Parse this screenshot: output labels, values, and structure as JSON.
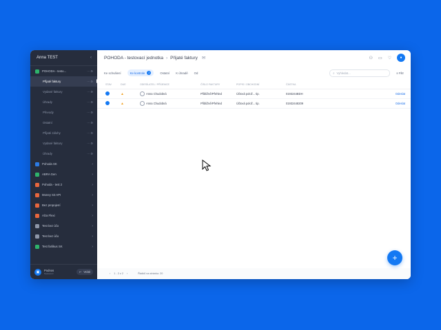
{
  "sidebar": {
    "user": "Anna TEST",
    "items": [
      {
        "label": "POHODA - testo...",
        "color": "#2eb36b",
        "tools": "⋯ ⚙",
        "sub": false,
        "active": false
      },
      {
        "label": "Přijaté faktury",
        "color": "",
        "tools": "⋯ ⚙",
        "sub": true,
        "active": true
      },
      {
        "label": "Vydané faktury",
        "color": "",
        "tools": "⋯ ⚙",
        "sub": true,
        "active": false
      },
      {
        "label": "Úhrady",
        "color": "",
        "tools": "⋯ ⚙",
        "sub": true,
        "active": false
      },
      {
        "label": "Převody",
        "color": "",
        "tools": "⋯ ⚙",
        "sub": true,
        "active": false
      },
      {
        "label": "Ostatní",
        "color": "",
        "tools": "⋯ ⚙",
        "sub": true,
        "active": false
      },
      {
        "label": "Přijaté zálohy",
        "color": "",
        "tools": "⋯ ⚙",
        "sub": true,
        "active": false
      },
      {
        "label": "Vydané faktury",
        "color": "",
        "tools": "⋯ ⚙",
        "sub": true,
        "active": false
      },
      {
        "label": "Úhrady",
        "color": "",
        "tools": "⋯ ⚙",
        "sub": true,
        "active": false
      },
      {
        "label": "Pohoda SK",
        "color": "#2c7be5",
        "tools": "",
        "sub": false,
        "active": false
      },
      {
        "label": "ABRA Gen",
        "color": "#2eb36b",
        "tools": "",
        "sub": false,
        "active": false
      },
      {
        "label": "Pohoda - test 2",
        "color": "#e8663d",
        "tools": "",
        "sub": false,
        "active": false
      },
      {
        "label": "Money S3 API",
        "color": "#e8663d",
        "tools": "",
        "sub": false,
        "active": false
      },
      {
        "label": "Bez propojení",
        "color": "#e8663d",
        "tools": "",
        "sub": false,
        "active": false
      },
      {
        "label": "Alza Flexi",
        "color": "#e8663d",
        "tools": "",
        "sub": false,
        "active": false
      },
      {
        "label": "Test bez účo",
        "color": "#8e96a8",
        "tools": "",
        "sub": false,
        "active": false
      },
      {
        "label": "Test bez účo",
        "color": "#8e96a8",
        "tools": "",
        "sub": false,
        "active": false
      },
      {
        "label": "Test farlikus SK",
        "color": "#2eb36b",
        "tools": "",
        "sub": false,
        "active": false
      }
    ],
    "footer": {
      "name": "Podnos",
      "sub": "Nastavení",
      "button": "Vrátit"
    }
  },
  "topbar": {
    "crumb1": "POHODA - testovací jednotka",
    "crumb2": "Přijaté faktury"
  },
  "filters": {
    "f1": "Ke schválení",
    "f2": "Ke kontrole",
    "f2_count": "2",
    "f3": "Ostatní",
    "f4": "K úhradě",
    "f5": "Od",
    "search_placeholder": "Vyhledat...",
    "filter_btn": "Filtr"
  },
  "table": {
    "headers": [
      "STAV",
      "DUE",
      "ODESÍLATEL / PŘÍJEMCE",
      "ČÍSLO FAKTURY",
      "POPIS / OBCHODNÍ",
      "ČÁSTKA",
      ""
    ],
    "rows": [
      {
        "person": "Anna Chudobná",
        "invoice": "Přibližně/Přehled",
        "desc": "Účtová polož... tip.",
        "amount": "0193244BDH",
        "action": "Odeslat"
      },
      {
        "person": "Anna Chudobná",
        "invoice": "Přibližně/Přehled",
        "desc": "Účtová polož... tip.",
        "amount": "01932448209",
        "action": "Odeslat"
      }
    ]
  },
  "pager": {
    "range": "1 - 2 z 2",
    "per_page": "Řádků na stránku: 20"
  },
  "colors": {
    "accent": "#1479f3",
    "sidebar": "#262d3d",
    "background": "#0b66ea"
  }
}
